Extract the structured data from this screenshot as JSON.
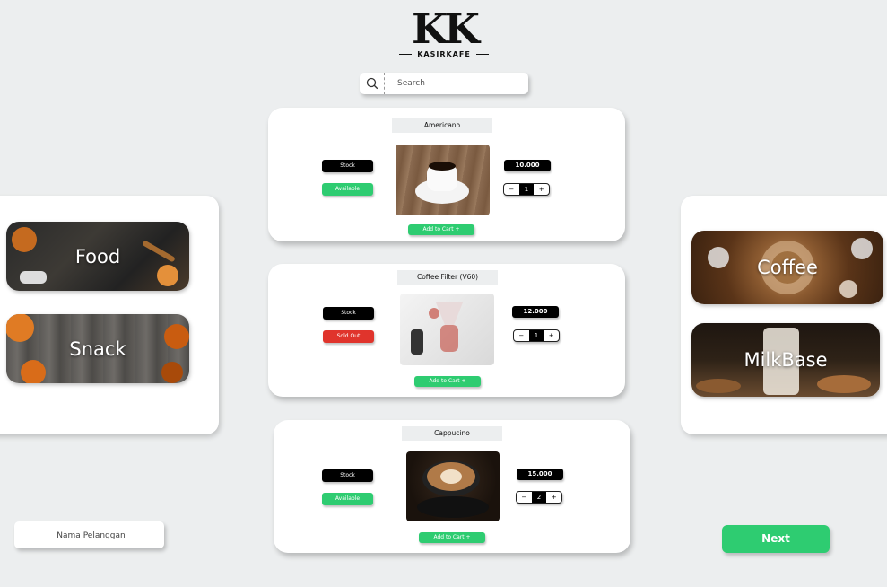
{
  "logo": {
    "mark": "KK",
    "name": "KASIRKAFE"
  },
  "search": {
    "placeholder": "Search",
    "icon": "search-icon"
  },
  "categories_left": [
    {
      "label": "Food"
    },
    {
      "label": "Snack"
    }
  ],
  "categories_right": [
    {
      "label": "Coffee"
    },
    {
      "label": "MilkBase"
    }
  ],
  "products": [
    {
      "name": "Americano",
      "stock_label": "Stock",
      "status": "Available",
      "price": "10.000",
      "qty": "1",
      "minus": "−",
      "plus": "+",
      "add_label": "Add to Cart +"
    },
    {
      "name": "Coffee Filter (V60)",
      "stock_label": "Stock",
      "status": "Sold Out",
      "price": "12.000",
      "qty": "1",
      "minus": "−",
      "plus": "+",
      "add_label": "Add to Cart +"
    },
    {
      "name": "Cappucino",
      "stock_label": "Stock",
      "status": "Available",
      "price": "15.000",
      "qty": "2",
      "minus": "−",
      "plus": "+",
      "add_label": "Add to Cart +"
    }
  ],
  "customer": {
    "placeholder": "Nama Pelanggan"
  },
  "next_label": "Next",
  "colors": {
    "green": "#2ecc71",
    "red": "#e0342c",
    "black": "#000000",
    "background": "#eceeef"
  }
}
